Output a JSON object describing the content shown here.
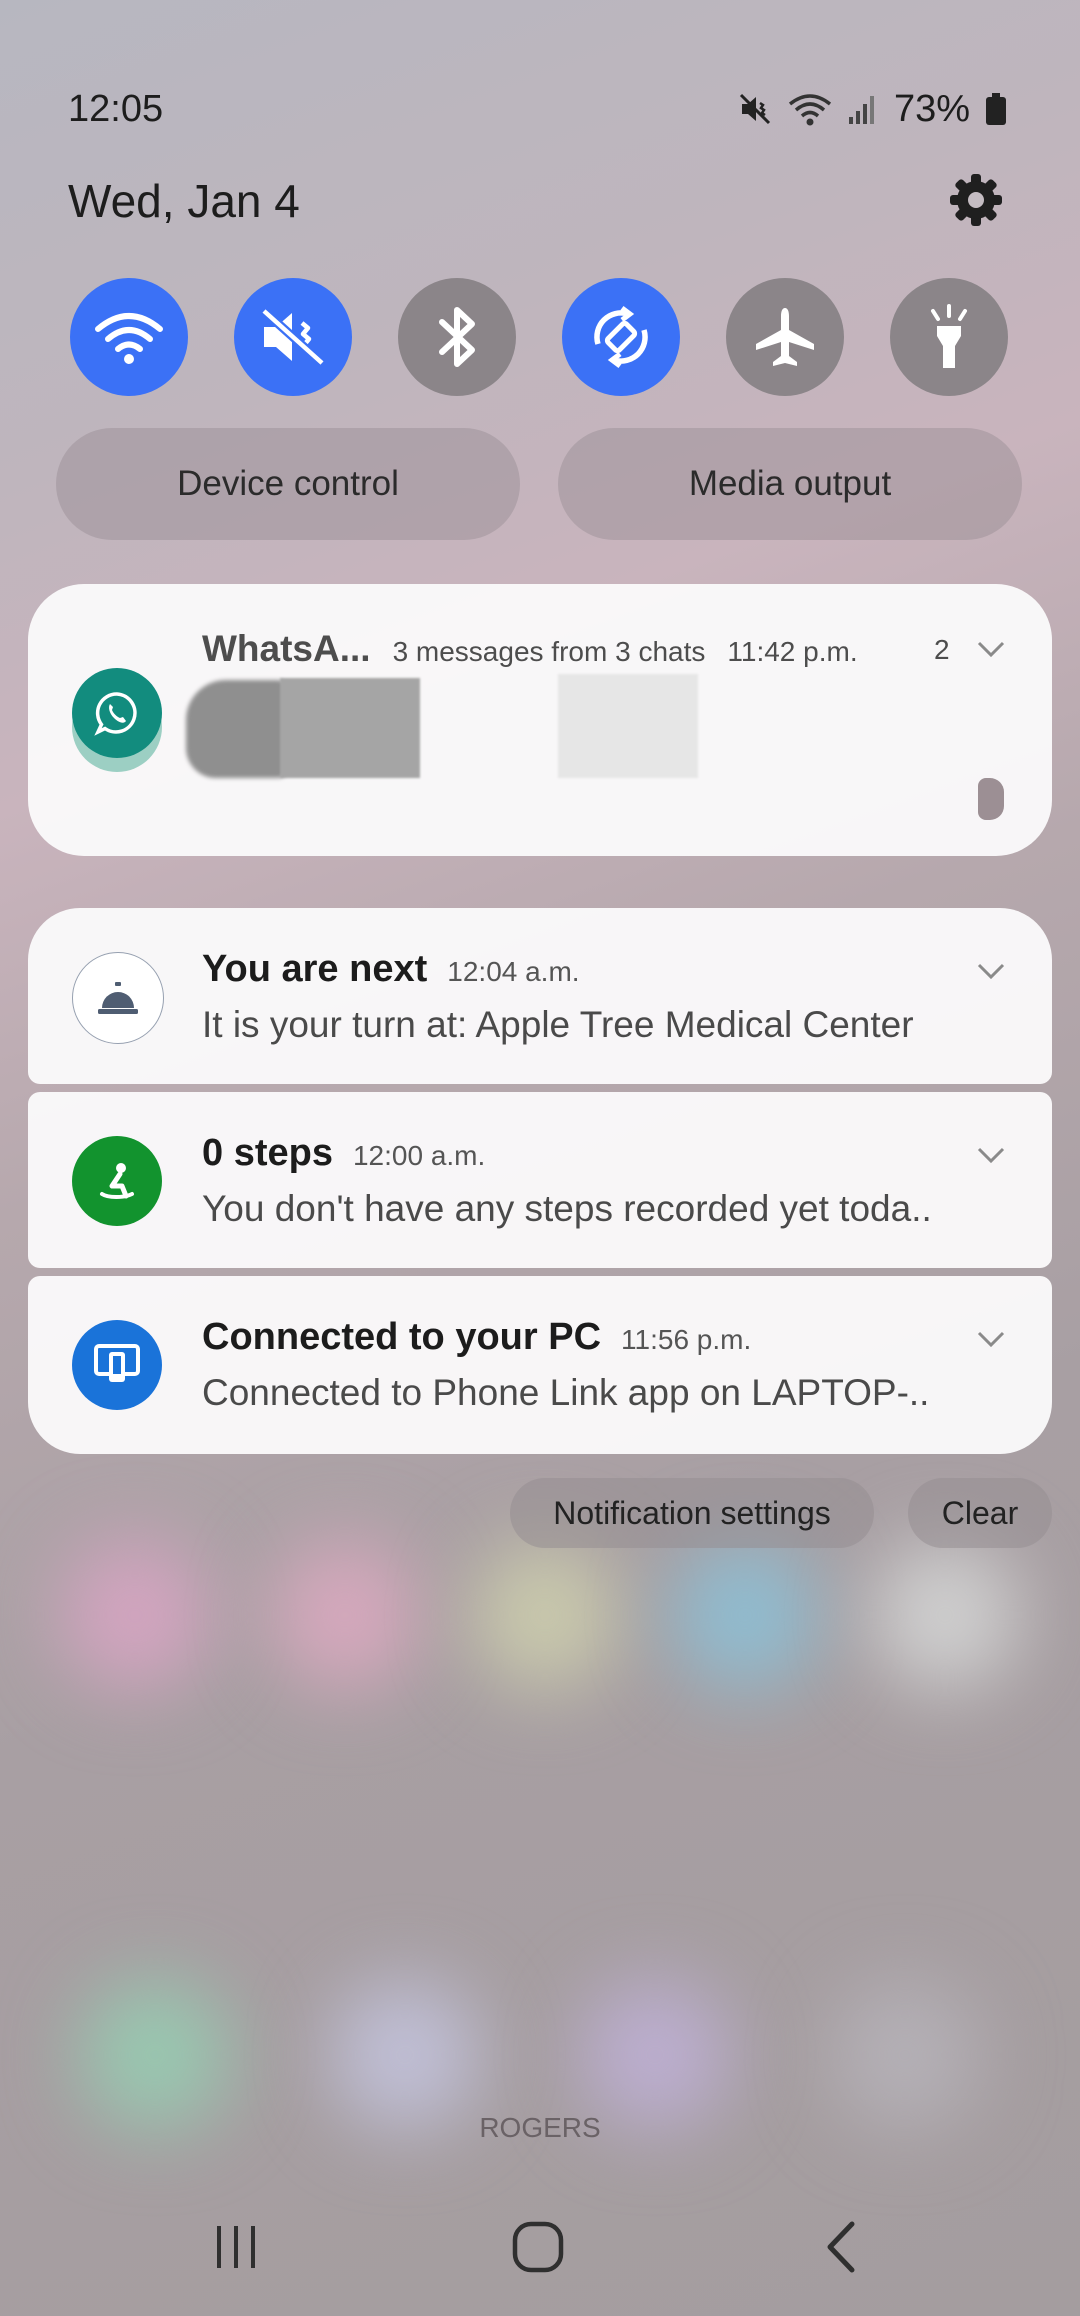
{
  "status_bar": {
    "time": "12:05",
    "battery_percent": "73%",
    "icons": [
      "mute-icon",
      "wifi-icon",
      "signal-icon",
      "battery-icon"
    ]
  },
  "header": {
    "date": "Wed, Jan 4",
    "settings_icon": "gear-icon"
  },
  "quick_settings": {
    "toggles": [
      {
        "name": "wifi",
        "icon": "wifi-icon",
        "active": true
      },
      {
        "name": "sound",
        "icon": "mute-icon",
        "active": true
      },
      {
        "name": "bluetooth",
        "icon": "bluetooth-icon",
        "active": false
      },
      {
        "name": "auto-rotate",
        "icon": "rotate-icon",
        "active": true
      },
      {
        "name": "airplane",
        "icon": "airplane-icon",
        "active": false
      },
      {
        "name": "flashlight",
        "icon": "flashlight-icon",
        "active": false
      }
    ],
    "device_control_label": "Device control",
    "media_output_label": "Media output"
  },
  "notifications": {
    "whatsapp": {
      "app": "WhatsA...",
      "summary": "3 messages from 3 chats",
      "time": "11:42 p.m.",
      "count": "2",
      "icon_color": "#128c7e"
    },
    "items": [
      {
        "title": "You are next",
        "time": "12:04 a.m.",
        "text": "It is your turn at: Apple Tree Medical Center",
        "icon": "service-bell-icon",
        "icon_color": "#ffffff"
      },
      {
        "title": "0 steps",
        "time": "12:00 a.m.",
        "text": "You don't have any steps recorded yet toda..",
        "icon": "health-icon",
        "icon_color": "#12932e"
      },
      {
        "title": "Connected to your PC",
        "time": "11:56 p.m.",
        "text": "Connected to Phone Link app on LAPTOP-..",
        "icon": "phone-link-icon",
        "icon_color": "#1a73d9"
      }
    ]
  },
  "actions": {
    "notification_settings_label": "Notification settings",
    "clear_label": "Clear"
  },
  "carrier": "ROGERS",
  "navigation": {
    "recents_icon": "recents-icon",
    "home_icon": "home-icon",
    "back_icon": "back-icon"
  }
}
